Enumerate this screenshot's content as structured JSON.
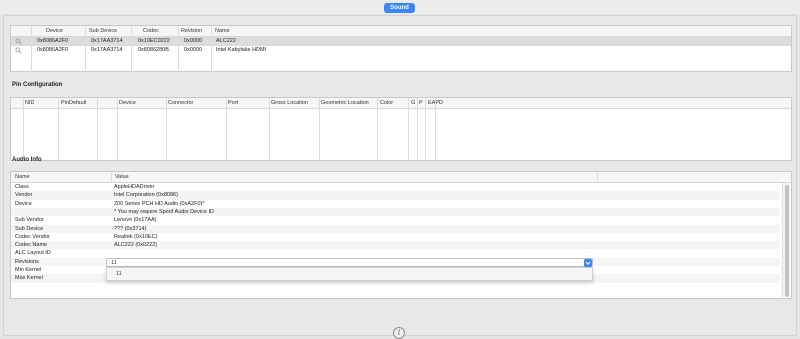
{
  "toolbar": {
    "active_tab": "Sound"
  },
  "devices": {
    "columns": [
      "Device",
      "Sub Device",
      "Codec",
      "Revision",
      "Name"
    ],
    "rows": [
      [
        "0x8086A2F0",
        "0x17AA3714",
        "0x10EC0222",
        "0x0000",
        "ALC222"
      ],
      [
        "0x8086A2F0",
        "0x17AA3714",
        "0x8086280B",
        "0x0000",
        "Intel Kabylake HDMI"
      ]
    ]
  },
  "pin_config": {
    "title": "Pin Configuration",
    "columns": [
      "NID",
      "PinDefault",
      "",
      "Device",
      "Connector",
      "Port",
      "Gross Location",
      "Geometric Location",
      "Color",
      "G",
      "P",
      "EAPD"
    ]
  },
  "audio_info": {
    "title": "Audio Info",
    "columns": [
      "Name",
      "Value"
    ],
    "rows": [
      [
        "Class",
        "AppleHDADriver"
      ],
      [
        "Vendor",
        "Intel Corporation (0x8086)"
      ],
      [
        "Device",
        "200 Series PCH HD Audio (0xA2F0)*"
      ],
      [
        "",
        "* You may require Spoof Audio Device ID"
      ],
      [
        "Sub Vendor",
        "Lenovo (0x17AA)"
      ],
      [
        "Sub Device",
        "??? (0x3714)"
      ],
      [
        "Codec Vendor",
        "Realtek (0x10EC)"
      ],
      [
        "Codec Name",
        "ALC222 (0x0222)"
      ],
      [
        "ALC Layout ID",
        ""
      ],
      [
        "Revisions",
        ""
      ],
      [
        "Min Kernel",
        "12"
      ],
      [
        "Max Kernel",
        "14"
      ]
    ],
    "layout_combo_value": "11",
    "dropdown_option": "11"
  },
  "icons": {
    "search": "magnifier-icon",
    "info": "info-icon"
  }
}
